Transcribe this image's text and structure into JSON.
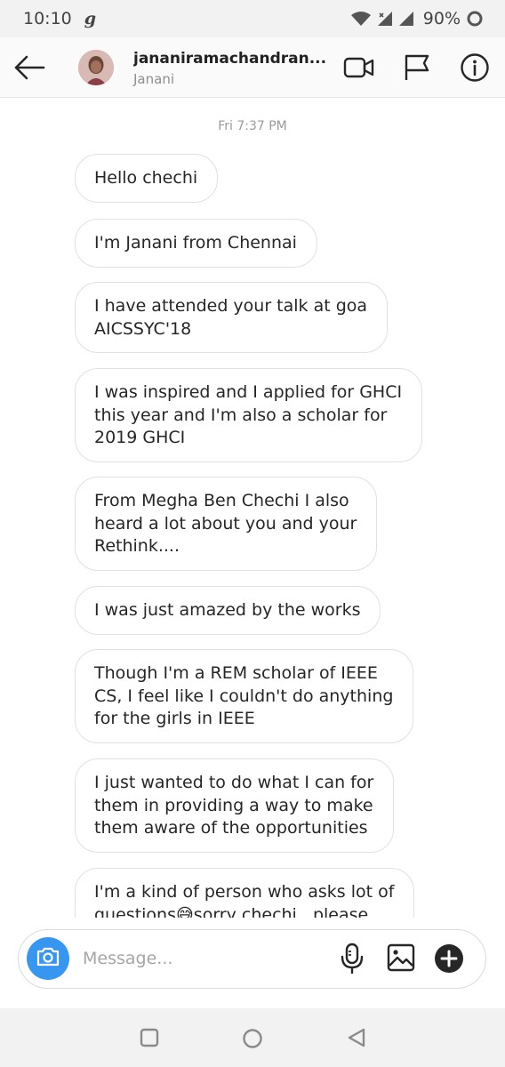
{
  "status_bar": {
    "time": "10:10",
    "app_glyph": "g",
    "battery": "90%",
    "icons": [
      "wifi-icon",
      "no-sim-icon",
      "signal-icon",
      "battery-ring-icon"
    ]
  },
  "header": {
    "username": "jananiramachandran...",
    "subtitle": "Janani",
    "icons": [
      "back-arrow-icon",
      "video-call-icon",
      "flag-icon",
      "info-icon"
    ]
  },
  "conversation": {
    "timestamp": "Fri 7:37 PM",
    "messages": [
      {
        "text": "Hello chechi"
      },
      {
        "text": "I'm Janani from Chennai"
      },
      {
        "text": "I have attended your talk at goa\nAICSSYC'18"
      },
      {
        "text": "I was inspired and I applied for GHCI\nthis year and I'm also a scholar for\n2019 GHCI"
      },
      {
        "text": "From Megha Ben Chechi I also\nheard a lot about you and your\nRethink...."
      },
      {
        "text": "I was just amazed by the works"
      },
      {
        "text": "Though I'm a REM scholar of IEEE\nCS, I feel like I couldn't do anything\nfor the girls in IEEE"
      },
      {
        "text": "I just wanted to do what I can for\nthem in providing a way to make\nthem aware of the opportunities"
      },
      {
        "text": "I'm a kind of person who asks lot of\nquestions😅sorry chechi , please"
      }
    ]
  },
  "composer": {
    "placeholder": "Message...",
    "icons": [
      "camera-icon",
      "microphone-icon",
      "gallery-icon",
      "add-icon"
    ]
  },
  "nav_bar": {
    "icons": [
      "recents-icon",
      "home-icon",
      "back-icon"
    ]
  },
  "colors": {
    "accent": "#3797f0",
    "bubble_border": "#e1e1e1",
    "text": "#262626",
    "muted": "#8e8e8e"
  }
}
